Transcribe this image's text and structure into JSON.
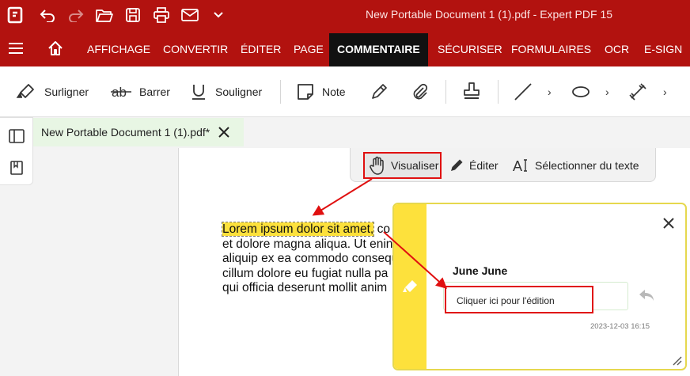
{
  "titlebar": {
    "title": "New Portable Document 1 (1).pdf   -   Expert PDF 15",
    "quick_access_icons": [
      "app-logo-icon",
      "undo-icon",
      "redo-icon",
      "open-folder-icon",
      "save-icon",
      "print-icon",
      "email-icon",
      "customize-dropdown-icon"
    ]
  },
  "menu": {
    "items": [
      "AFFICHAGE",
      "CONVERTIR",
      "ÉDITER",
      "PAGE",
      "COMMENTAIRE",
      "SÉCURISER",
      "FORMULAIRES",
      "OCR",
      "E-SIGN"
    ],
    "active": "COMMENTAIRE"
  },
  "ribbon": {
    "surligner": "Surligner",
    "barrer": "Barrer",
    "souligner": "Souligner",
    "note": "Note",
    "chevron": "›"
  },
  "tab": {
    "label": "New Portable Document 1 (1).pdf*"
  },
  "floatbar": {
    "visualiser": "Visualiser",
    "editer": "Éditer",
    "selectionner": "Sélectionner du texte"
  },
  "document": {
    "line1_highlight": "Lorem ipsum dolor sit amet,",
    "line1_rest": "co",
    "line2": "et dolore magna aliqua. Ut enin",
    "line3": "aliquip ex ea commodo consequ",
    "line4": "cillum dolore eu fugiat nulla pa",
    "line5": "qui officia deserunt mollit anim"
  },
  "comment": {
    "author": "June June",
    "edit_placeholder": "Cliquer ici pour l'édition",
    "date": "2023-12-03 16:15"
  },
  "colors": {
    "brand_red": "#b2120f",
    "active_tab": "#111111",
    "highlight": "#fde13c",
    "annotation_red": "#e01010",
    "tab_green": "#e8f6e4"
  }
}
